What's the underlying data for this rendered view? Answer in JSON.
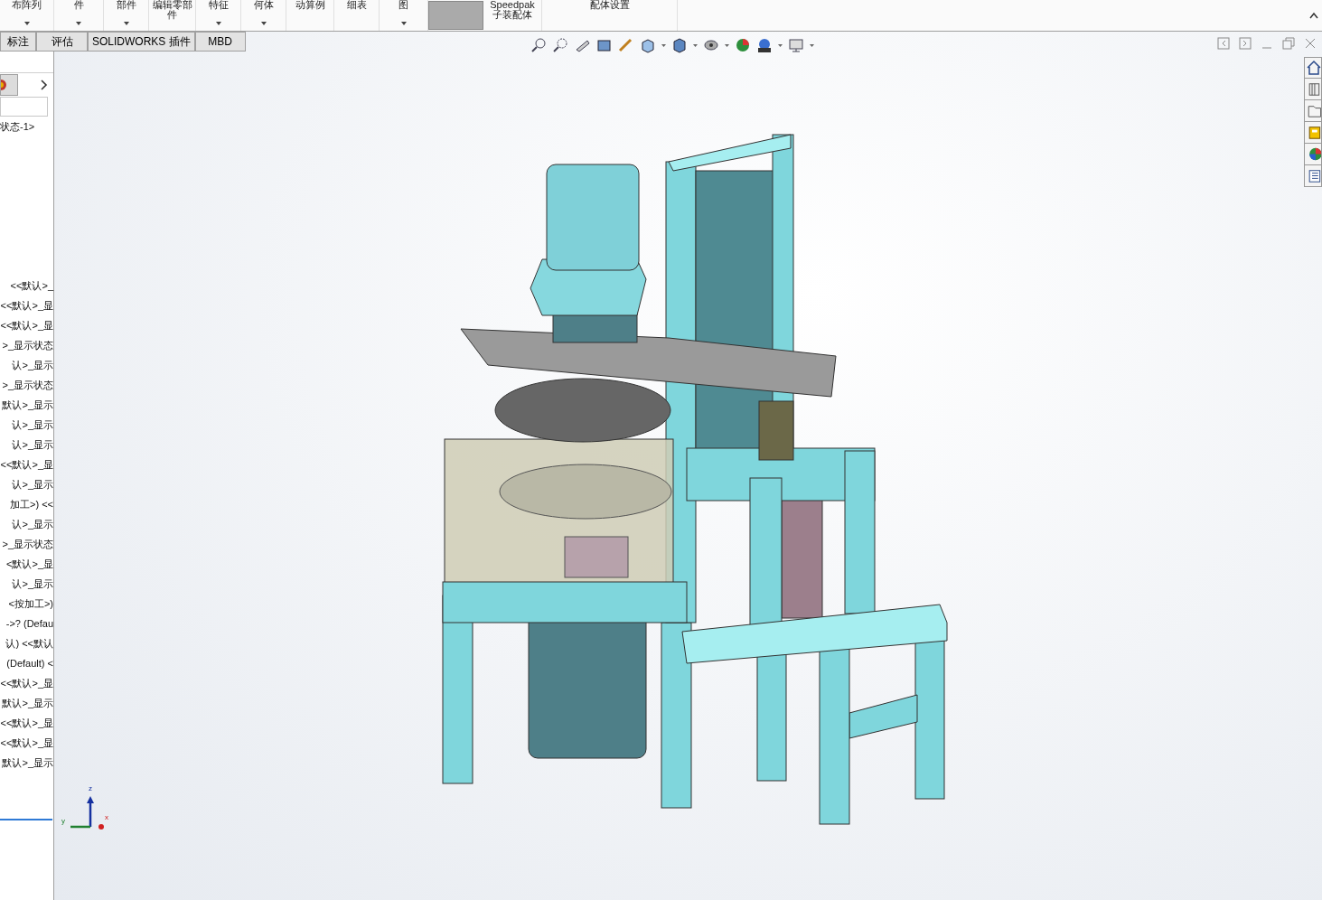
{
  "ribbon": {
    "buttons": [
      {
        "kind": "command",
        "label": "布阵列",
        "dropdown": true
      },
      {
        "kind": "command",
        "label": "件",
        "dropdown": true
      },
      {
        "kind": "command",
        "label": "部件",
        "dropdown": true
      },
      {
        "kind": "command",
        "label": "编辑零部件",
        "dropdown": false
      },
      {
        "kind": "command",
        "label": "特征",
        "dropdown": true
      },
      {
        "kind": "command",
        "label": "何体",
        "dropdown": true
      },
      {
        "kind": "command",
        "label": "动算例",
        "dropdown": false
      },
      {
        "kind": "command",
        "label": "细表",
        "dropdown": false
      },
      {
        "kind": "command",
        "label": "图",
        "dropdown": true
      },
      {
        "kind": "blank"
      },
      {
        "kind": "command",
        "label": "Speedpak 子装配体",
        "dropdown": false
      },
      {
        "kind": "command",
        "label": "配体设置",
        "dropdown": false
      }
    ]
  },
  "tabs": [
    {
      "label": "标注",
      "selected": false
    },
    {
      "label": "评估",
      "selected": false
    },
    {
      "label": "SOLIDWORKS 插件",
      "selected": false
    },
    {
      "label": "MBD",
      "selected": false
    }
  ],
  "tree": {
    "header": "状态-1>",
    "rows": [
      "<<默认>_",
      "<<默认>_显",
      "<<默认>_显",
      ">_显示状态",
      "认>_显示",
      ">_显示状态",
      "默认>_显示",
      "认>_显示",
      "认>_显示",
      "<<默认>_显",
      "认>_显示",
      "加工>) <<",
      "认>_显示",
      ">_显示状态",
      "<默认>_显",
      "认>_显示",
      "<按加工>)",
      "->? (Defau",
      "认) <<默认",
      "(Default) <",
      "<<默认>_显",
      "默认>_显示",
      "<<默认>_显",
      "<<默认>_显",
      "默认>_显示"
    ]
  },
  "triad": {
    "z": "z",
    "y": "y",
    "x": "x"
  }
}
